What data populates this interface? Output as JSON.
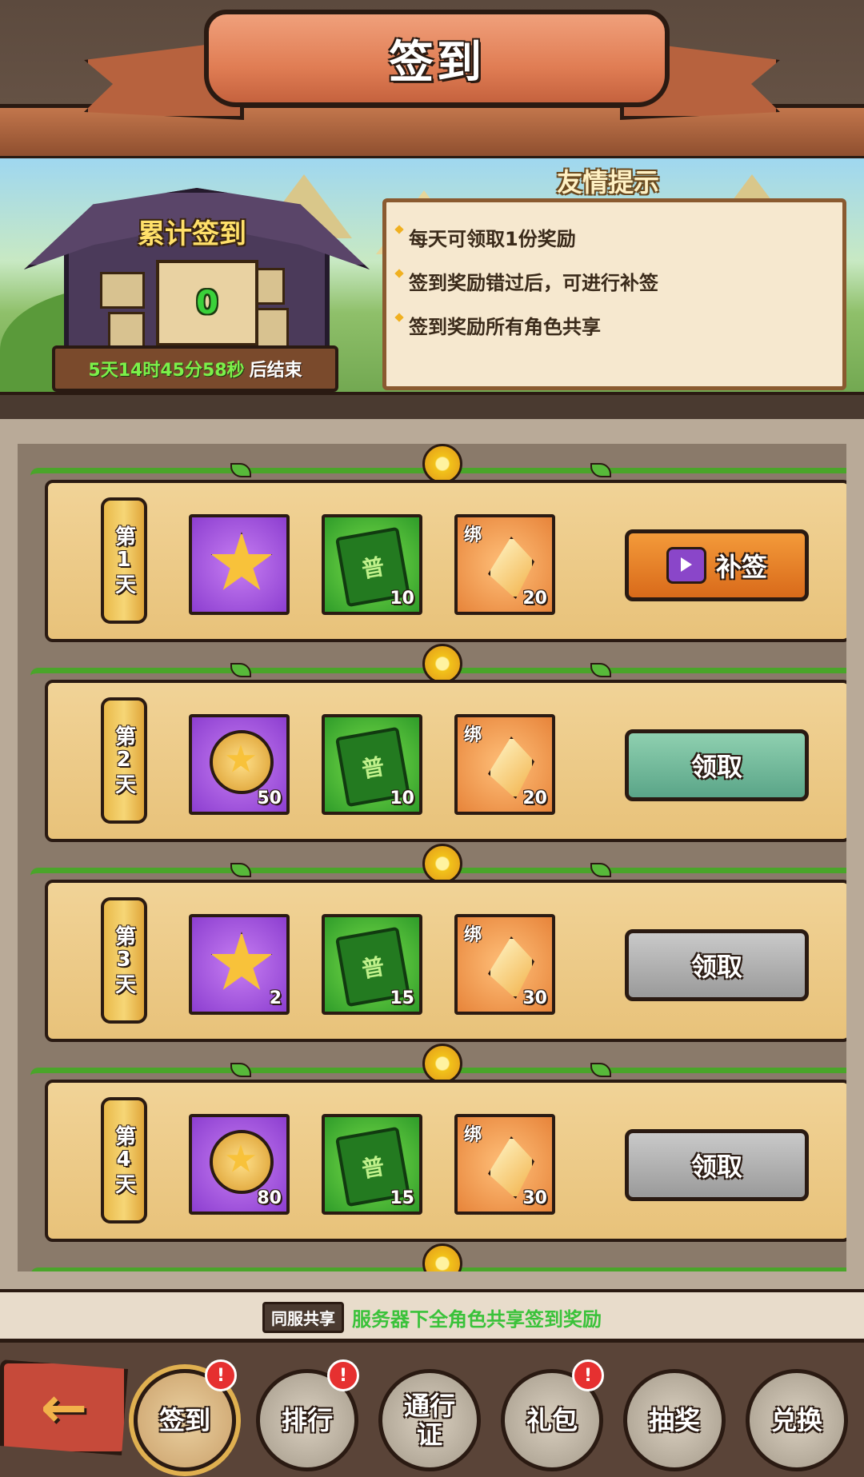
{
  "header": {
    "title": "签到"
  },
  "cumulative": {
    "title": "累计签到",
    "count": "0",
    "countdown": "5天14时45分58秒",
    "countdown_suffix": "后结束"
  },
  "tips": {
    "title": "友情提示",
    "items": [
      "每天可领取1份奖励",
      "签到奖励错过后，可进行补签",
      "签到奖励所有角色共享"
    ]
  },
  "days": [
    {
      "label": "第1天",
      "items": [
        {
          "type": "star",
          "qty": ""
        },
        {
          "type": "book",
          "glyph": "普",
          "qty": "10"
        },
        {
          "type": "shard",
          "glyph": "绑",
          "qty": "20"
        }
      ],
      "button": "补签",
      "button_state": "makeup"
    },
    {
      "label": "第2天",
      "items": [
        {
          "type": "medal",
          "qty": "50"
        },
        {
          "type": "book",
          "glyph": "普",
          "qty": "10"
        },
        {
          "type": "shard",
          "glyph": "绑",
          "qty": "20"
        }
      ],
      "button": "领取",
      "button_state": "available"
    },
    {
      "label": "第3天",
      "items": [
        {
          "type": "star",
          "qty": "2"
        },
        {
          "type": "book",
          "glyph": "普",
          "qty": "15"
        },
        {
          "type": "shard",
          "glyph": "绑",
          "qty": "30"
        }
      ],
      "button": "领取",
      "button_state": "locked"
    },
    {
      "label": "第4天",
      "items": [
        {
          "type": "medal",
          "qty": "80"
        },
        {
          "type": "book",
          "glyph": "普",
          "qty": "15"
        },
        {
          "type": "shard",
          "glyph": "绑",
          "qty": "30"
        }
      ],
      "button": "领取",
      "button_state": "locked"
    }
  ],
  "share": {
    "badge": "同服共享",
    "text": "服务器下全角色共享签到奖励"
  },
  "nav": {
    "tabs": [
      {
        "label": "签到",
        "active": true,
        "badge": "!"
      },
      {
        "label": "排行",
        "active": false,
        "badge": "!"
      },
      {
        "label": "通行证",
        "active": false,
        "badge": ""
      },
      {
        "label": "礼包",
        "active": false,
        "badge": "!"
      },
      {
        "label": "抽奖",
        "active": false,
        "badge": ""
      },
      {
        "label": "兑换",
        "active": false,
        "badge": ""
      }
    ]
  },
  "colors": {
    "accent": "#e07d54",
    "claim": "#5aa588",
    "makeup": "#d96a1a",
    "locked": "#9a9a9a",
    "share_text": "#3ac23a"
  }
}
